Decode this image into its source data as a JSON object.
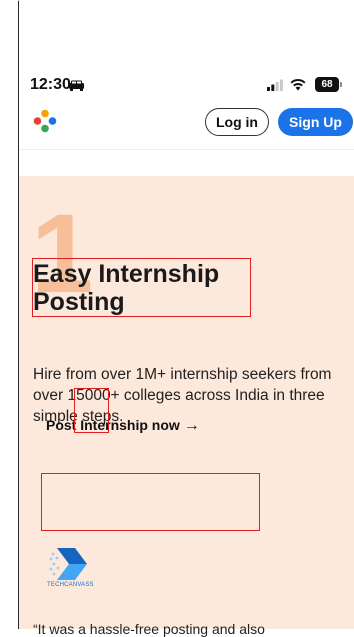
{
  "status_bar": {
    "time": "12:30",
    "car_icon": "car-icon",
    "signal_icon": "signal-icon",
    "wifi_icon": "wifi-icon",
    "battery_level": "68"
  },
  "header": {
    "logo_icon": "compass-logo-icon",
    "login_label": "Log in",
    "signup_label": "Sign Up",
    "signup_color": "#1a73e8"
  },
  "hero": {
    "background": "#fde8dc",
    "step_number": "1",
    "title": "Easy Internship Posting",
    "description": "Hire from over 1M+ internship seekers from over 15000+ colleges across India in three simple steps.",
    "cta_label": "Post Internship now",
    "cta_arrow": "→",
    "partner_name": "TECHCANVASS",
    "testimonial_snippet": "“It was a hassle-free posting and also"
  }
}
